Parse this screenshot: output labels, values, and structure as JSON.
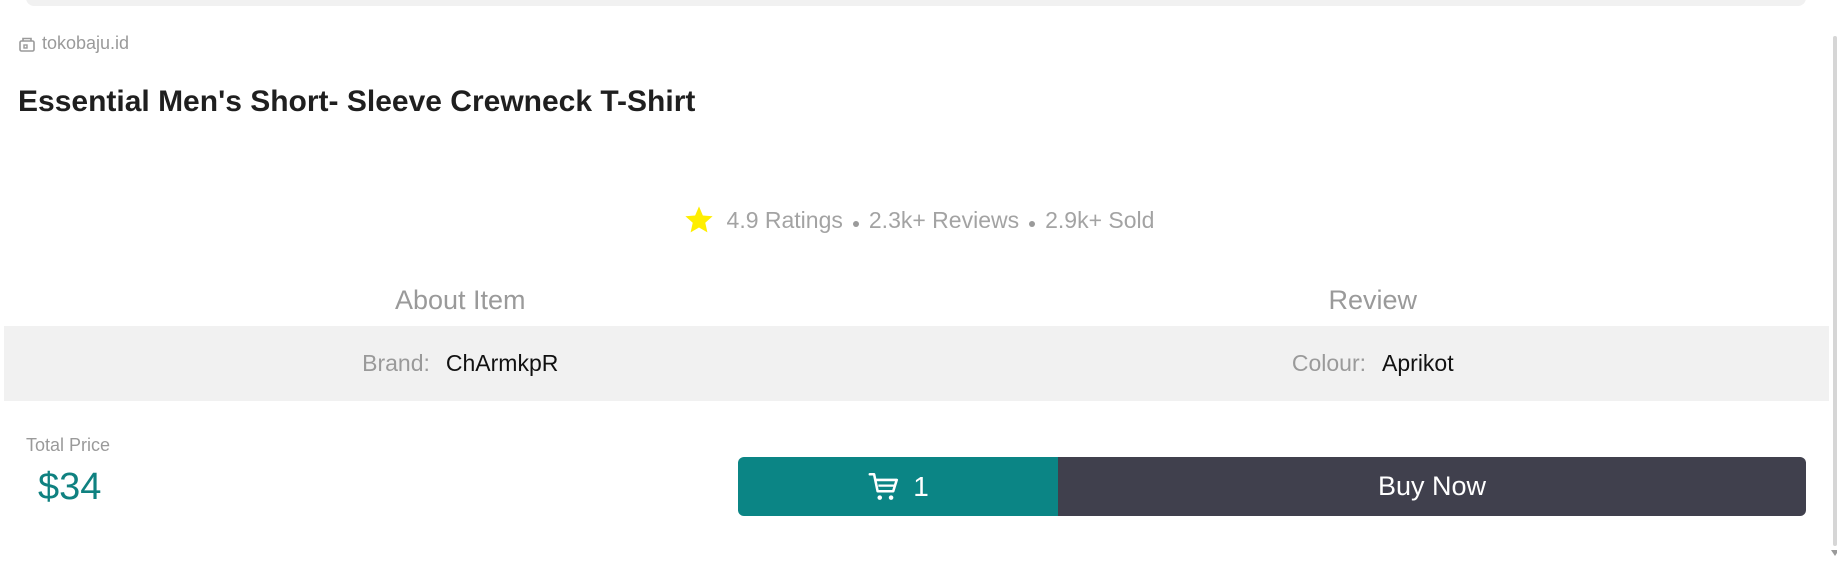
{
  "store": {
    "name": "tokobaju.id",
    "icon": "store-icon"
  },
  "product": {
    "title": "Essential Men's Short- Sleeve Crewneck T-Shirt"
  },
  "stats": {
    "rating": "4.9 Ratings",
    "reviews": "2.3k+ Reviews",
    "sold": "2.9k+ Sold",
    "star_color": "#ffee00"
  },
  "tabs": [
    {
      "label": "About Item"
    },
    {
      "label": "Review"
    }
  ],
  "specs": [
    {
      "label": "Brand:",
      "value": "ChArmkpR"
    },
    {
      "label": "Colour:",
      "value": "Aprikot"
    }
  ],
  "price": {
    "label": "Total Price",
    "value": "$34"
  },
  "actions": {
    "cart_count": "1",
    "cart_icon": "cart-icon",
    "buy_label": "Buy Now"
  },
  "colors": {
    "accent": "#0b8585",
    "dark": "#40404d",
    "muted": "#9a9a9a"
  }
}
